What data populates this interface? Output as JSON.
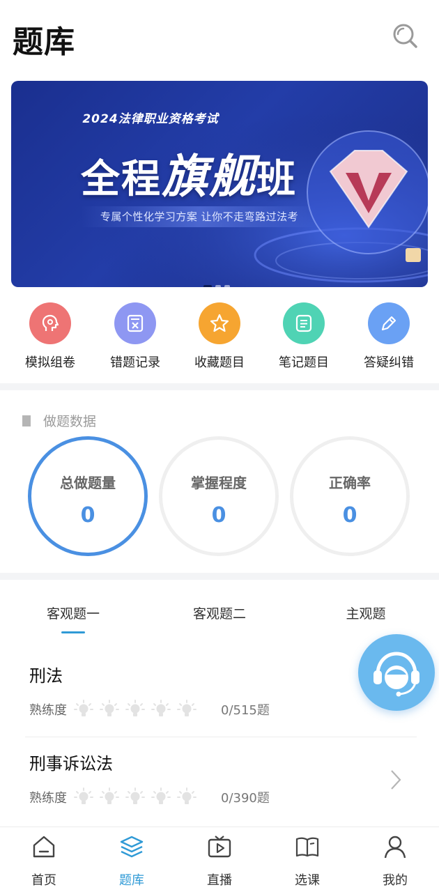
{
  "header": {
    "title": "题库",
    "search_icon": "search-icon"
  },
  "banner": {
    "year_line": "2024法律职业资格考试",
    "headline_parts": [
      "全程",
      "旗",
      "舰",
      "班"
    ],
    "subtitle": "专属个性化学习方案 让你不走弯路过法考",
    "dots": 3,
    "active_dot": 0
  },
  "quick_actions": [
    {
      "label": "模拟组卷",
      "icon": "head-icon",
      "color": "#ee7474"
    },
    {
      "label": "错题记录",
      "icon": "wrong-doc-icon",
      "color": "#8e97f2"
    },
    {
      "label": "收藏题目",
      "icon": "star-icon",
      "color": "#f6a531"
    },
    {
      "label": "笔记题目",
      "icon": "notes-icon",
      "color": "#4fd3b4"
    },
    {
      "label": "答疑纠错",
      "icon": "edit-icon",
      "color": "#6aa1f4"
    }
  ],
  "stats": {
    "title": "做题数据",
    "items": [
      {
        "label": "总做题量",
        "value": "0"
      },
      {
        "label": "掌握程度",
        "value": "0"
      },
      {
        "label": "正确率",
        "value": "0"
      }
    ]
  },
  "tabs": [
    {
      "label": "客观题一",
      "active": true
    },
    {
      "label": "客观题二",
      "active": false
    },
    {
      "label": "主观题",
      "active": false
    }
  ],
  "subjects": [
    {
      "name": "刑法",
      "proficiency_label": "熟练度",
      "level": 0,
      "max_level": 5,
      "progress": "0/515题"
    },
    {
      "name": "刑事诉讼法",
      "proficiency_label": "熟练度",
      "level": 0,
      "max_level": 5,
      "progress": "0/390题"
    }
  ],
  "floating_button": {
    "icon": "customer-service-icon"
  },
  "tabbar": [
    {
      "label": "首页",
      "icon": "home-icon",
      "active": false
    },
    {
      "label": "题库",
      "icon": "layers-icon",
      "active": true
    },
    {
      "label": "直播",
      "icon": "tv-play-icon",
      "active": false
    },
    {
      "label": "选课",
      "icon": "book-icon",
      "active": false
    },
    {
      "label": "我的",
      "icon": "user-icon",
      "active": false
    }
  ],
  "colors": {
    "accent": "#2f9ad6",
    "ring_active": "#4a90e2",
    "banner_bg": "#1f359c"
  }
}
